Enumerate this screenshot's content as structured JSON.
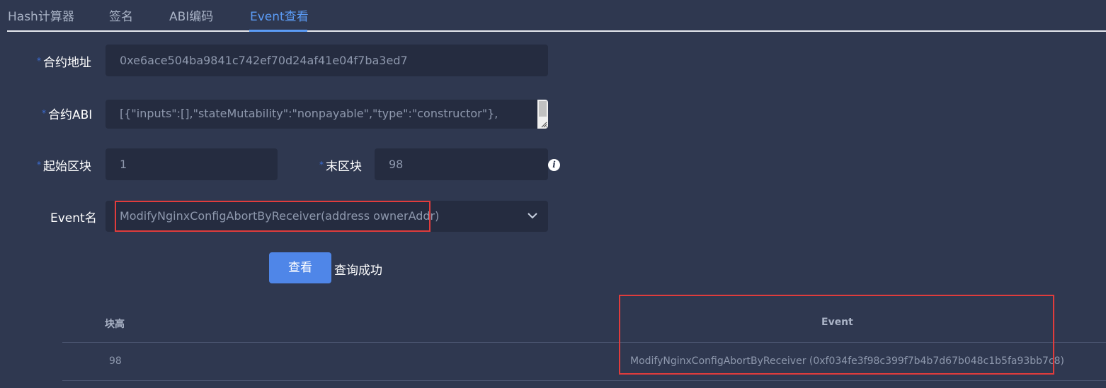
{
  "tabs": [
    {
      "label": "Hash计算器"
    },
    {
      "label": "签名"
    },
    {
      "label": "ABI编码"
    },
    {
      "label": "Event查看",
      "active": true
    }
  ],
  "form": {
    "contract_address": {
      "label": "合约地址",
      "value": "0xe6ace504ba9841c742ef70d24af41e04f7ba3ed7"
    },
    "contract_abi": {
      "label": "合约ABI",
      "value": "[{\"inputs\":[],\"stateMutability\":\"nonpayable\",\"type\":\"constructor\"},"
    },
    "start_block": {
      "label": "起始区块",
      "value": "1"
    },
    "end_block": {
      "label": "末区块",
      "value": "98"
    },
    "event_name": {
      "label": "Event名",
      "value": "ModifyNginxConfigAbortByReceiver(address ownerAddr)"
    },
    "required_mark": "*"
  },
  "actions": {
    "query_label": "查看",
    "status_text": "查询成功"
  },
  "table": {
    "columns": [
      "块高",
      "Event"
    ],
    "rows": [
      {
        "block": "98",
        "event": "ModifyNginxConfigAbortByReceiver (0xf034fe3f98c399f7b4b7d67b048c1b5fa93bb7c8)"
      }
    ]
  },
  "colors": {
    "background": "#2f3850",
    "field_bg": "#252c40",
    "accent": "#5b9bf5",
    "button": "#4f86e8",
    "highlight": "#e03c3c"
  },
  "icons": {
    "info": "info-icon",
    "dropdown": "chevron-down-icon",
    "resize": "resize-grip-icon"
  }
}
